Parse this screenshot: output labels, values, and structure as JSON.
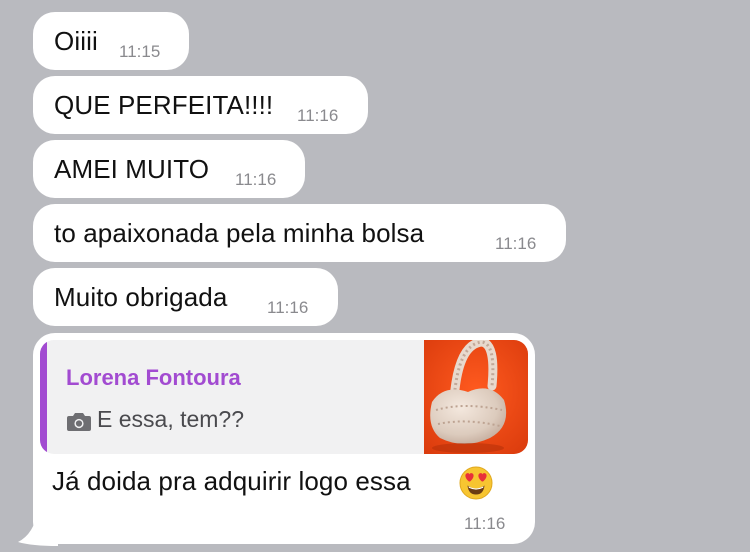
{
  "messages": [
    {
      "text": "Oiiii",
      "time": "11:15"
    },
    {
      "text": "QUE PERFEITA!!!!",
      "time": "11:16"
    },
    {
      "text": "AMEI MUITO",
      "time": "11:16"
    },
    {
      "text": "to apaixonada pela minha bolsa",
      "time": "11:16"
    },
    {
      "text": "Muito obrigada",
      "time": "11:16"
    }
  ],
  "reply_message": {
    "quote": {
      "author": "Lorena Fontoura",
      "text": "E essa, tem??",
      "icon": "camera-icon",
      "thumbnail": "bag-photo-thumbnail"
    },
    "text": "Já doida pra adquirir logo essa",
    "emoji": "heart-eyes-emoji",
    "time": "11:16"
  },
  "colors": {
    "background": "#b9babf",
    "bubble": "#ffffff",
    "quote_accent": "#a24bd1",
    "timestamp": "#8a8a8e"
  }
}
